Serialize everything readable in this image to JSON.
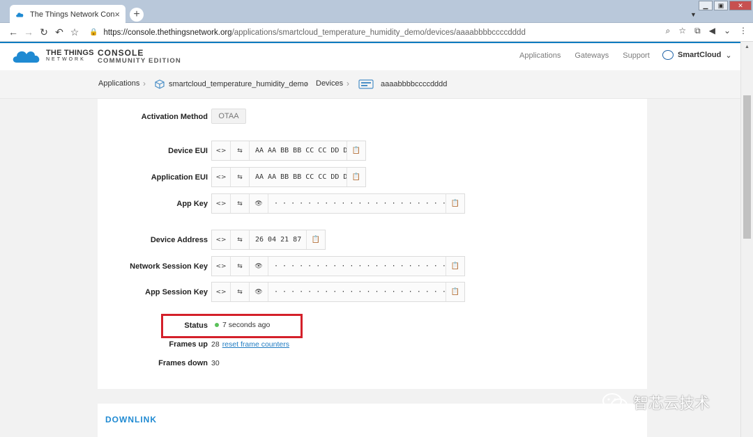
{
  "browser": {
    "tab_title": "The Things Network Console",
    "tab_close": "×",
    "new_tab": "+",
    "url_host": "https://console.thethingsnetwork.org",
    "url_path": "/applications/smartcloud_temperature_humidity_demo/devices/aaaabbbbccccdddd"
  },
  "header": {
    "logo_line1": "THE THINGS",
    "logo_line2": "NETWORK",
    "console_title": "CONSOLE",
    "console_edition": "COMMUNITY EDITION",
    "nav": [
      "Applications",
      "Gateways",
      "Support"
    ],
    "user": "SmartCloud"
  },
  "breadcrumb": {
    "applications": "Applications",
    "app_name": "smartcloud_temperature_humidity_demo",
    "devices": "Devices",
    "device_id": "aaaabbbbccccdddd"
  },
  "device": {
    "activation_label": "Activation Method",
    "activation_value": "OTAA",
    "device_eui_label": "Device EUI",
    "device_eui": "AA AA BB BB CC CC DD DD",
    "app_eui_label": "Application EUI",
    "app_eui": "AA AA BB BB CC CC DD DD",
    "app_key_label": "App Key",
    "masked": "· · · · · · · · · · · · · · · · · · · · · · · · · · · · · · · ·",
    "device_address_label": "Device Address",
    "device_address": "26 04 21 87",
    "nwk_skey_label": "Network Session Key",
    "app_skey_label": "App Session Key",
    "status_label": "Status",
    "status_value": "7 seconds ago",
    "frames_up_label": "Frames up",
    "frames_up": "28",
    "reset_link": "reset frame counters",
    "frames_down_label": "Frames down",
    "frames_down": "30"
  },
  "sections": {
    "downlink": "DOWNLINK"
  },
  "watermark": "智芯云技术",
  "icons": {
    "code": "<>",
    "swap": "⇆",
    "eye": "👁",
    "copy": "📋"
  },
  "colors": {
    "brand_blue": "#0f7cc0",
    "status_green": "#59c159",
    "highlight_red": "#d4202a",
    "link_blue": "#1f7bc2"
  }
}
